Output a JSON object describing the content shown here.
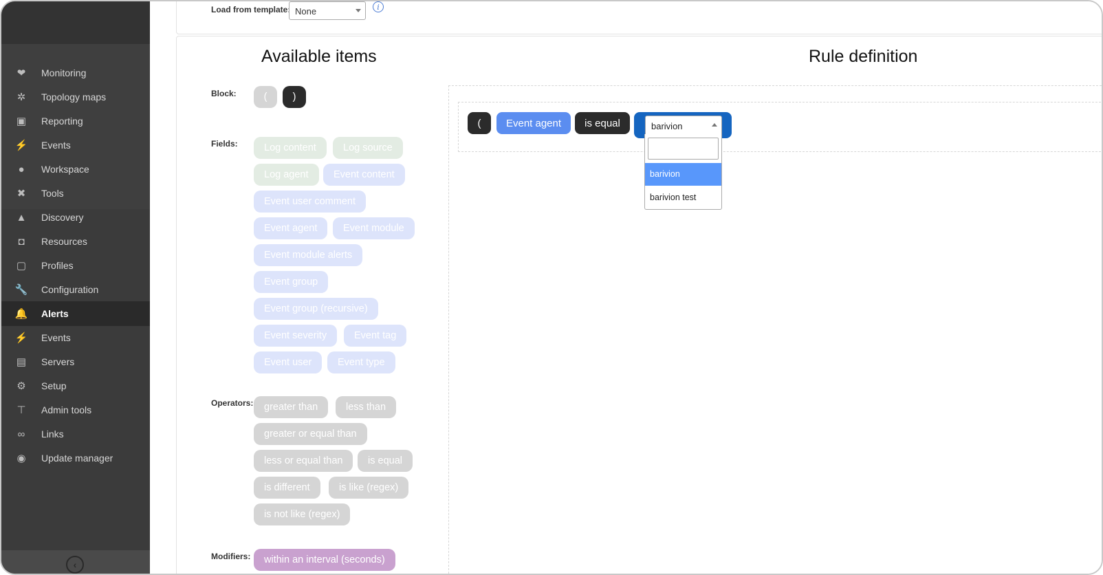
{
  "sidebar": {
    "items": [
      {
        "label": "Monitoring",
        "icon": "heartbeat-icon",
        "glyph": "❤"
      },
      {
        "label": "Topology maps",
        "icon": "topology-icon",
        "glyph": "✲"
      },
      {
        "label": "Reporting",
        "icon": "report-icon",
        "glyph": "▣"
      },
      {
        "label": "Events",
        "icon": "lightning-icon",
        "glyph": "⚡"
      },
      {
        "label": "Workspace",
        "icon": "user-icon",
        "glyph": "●"
      },
      {
        "label": "Tools",
        "icon": "tools-icon",
        "glyph": "✖"
      },
      {
        "label": "Discovery",
        "icon": "discovery-icon",
        "glyph": "▲"
      },
      {
        "label": "Resources",
        "icon": "resources-icon",
        "glyph": "◘"
      },
      {
        "label": "Profiles",
        "icon": "profile-icon",
        "glyph": "▢"
      },
      {
        "label": "Configuration",
        "icon": "wrench-icon",
        "glyph": "🔧"
      },
      {
        "label": "Alerts",
        "icon": "bell-icon",
        "glyph": "🔔"
      },
      {
        "label": "Events",
        "icon": "lightning-icon",
        "glyph": "⚡"
      },
      {
        "label": "Servers",
        "icon": "server-icon",
        "glyph": "▤"
      },
      {
        "label": "Setup",
        "icon": "gear-icon",
        "glyph": "⚙"
      },
      {
        "label": "Admin tools",
        "icon": "admin-tools-icon",
        "glyph": "⊤"
      },
      {
        "label": "Links",
        "icon": "link-icon",
        "glyph": "∞"
      },
      {
        "label": "Update manager",
        "icon": "update-icon",
        "glyph": "◉"
      }
    ],
    "active": "Alerts",
    "collapse_icon": "chevron-left-icon",
    "collapse_glyph": "‹"
  },
  "template": {
    "label": "Load from template:",
    "selected": "None",
    "info_glyph": "i"
  },
  "available": {
    "title": "Available items",
    "block_label": "Block:",
    "block_open": "(",
    "block_close": ")",
    "fields_label": "Fields:",
    "fields": [
      "Log content",
      "Log source",
      "Log agent",
      "Event content",
      "Event user comment",
      "Event agent",
      "Event module",
      "Event module alerts",
      "Event group",
      "Event group (recursive)",
      "Event severity",
      "Event tag",
      "Event user",
      "Event type"
    ],
    "operators_label": "Operators:",
    "operators": [
      "greater than",
      "less than",
      "greater or equal than",
      "less or equal than",
      "is equal",
      "is different",
      "is like (regex)",
      "is not like (regex)"
    ],
    "modifiers_label": "Modifiers:",
    "modifiers": [
      "within an interval (seconds)"
    ]
  },
  "rule": {
    "title": "Rule definition",
    "open_paren": "(",
    "field": "Event agent",
    "operator": "is equal",
    "value": "barivion",
    "search_value": "",
    "options": [
      "barivion",
      "barivion test"
    ]
  },
  "colors": {
    "sidebar_bg": "#3b3b3b",
    "active_nav": "#2a2a2a",
    "field_blue": "#5b8df0",
    "value_bg": "#1565c0",
    "highlight": "#5897fb"
  }
}
